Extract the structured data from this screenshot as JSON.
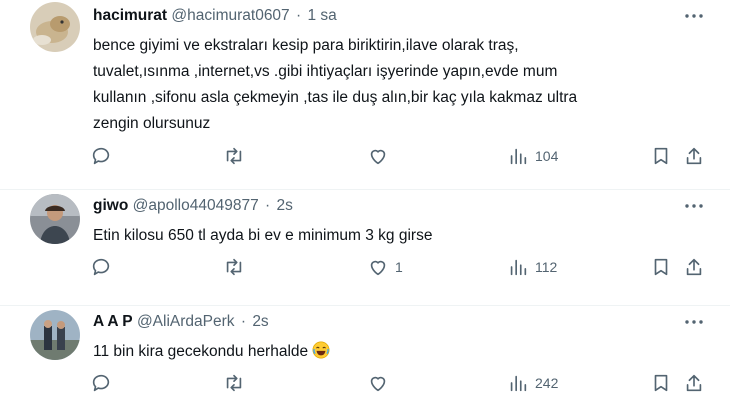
{
  "tweets": [
    {
      "name": "hacimurat",
      "handle": "@hacimurat0607",
      "separator": "·",
      "time": "1 sa",
      "text_lines": [
        "bence giyimi ve ekstraları kesip para biriktirin,ilave olarak traş,",
        "tuvalet,ısınma ,internet,vs .gibi ihtiyaçları işyerinde yapın,evde mum",
        "kullanın ,sifonu asla çekmeyin ,tas ile duş alın,bir kaç yıla kakmaz ultra",
        "zengin olursunuz"
      ],
      "likes": "",
      "views": "104"
    },
    {
      "name": "giwo",
      "handle": "@apollo44049877",
      "separator": "·",
      "time": "2s",
      "text_lines": [
        "Etin kilosu 650 tl  ayda bi ev e minimum 3 kg girse"
      ],
      "likes": "1",
      "views": "112"
    },
    {
      "name": "A A P",
      "handle": "@AliArdaPerk",
      "separator": "·",
      "time": "2s",
      "text_lines": [
        "11 bin kira gecekondu herhalde"
      ],
      "emoji": "joy-emoji",
      "likes": "",
      "views": "242"
    }
  ],
  "colors": {
    "text": "#0f1419",
    "muted": "#536471",
    "divider": "#eff3f4"
  },
  "icons": [
    "more-icon",
    "reply-icon",
    "retweet-icon",
    "like-icon",
    "views-icon",
    "bookmark-icon",
    "share-icon"
  ]
}
